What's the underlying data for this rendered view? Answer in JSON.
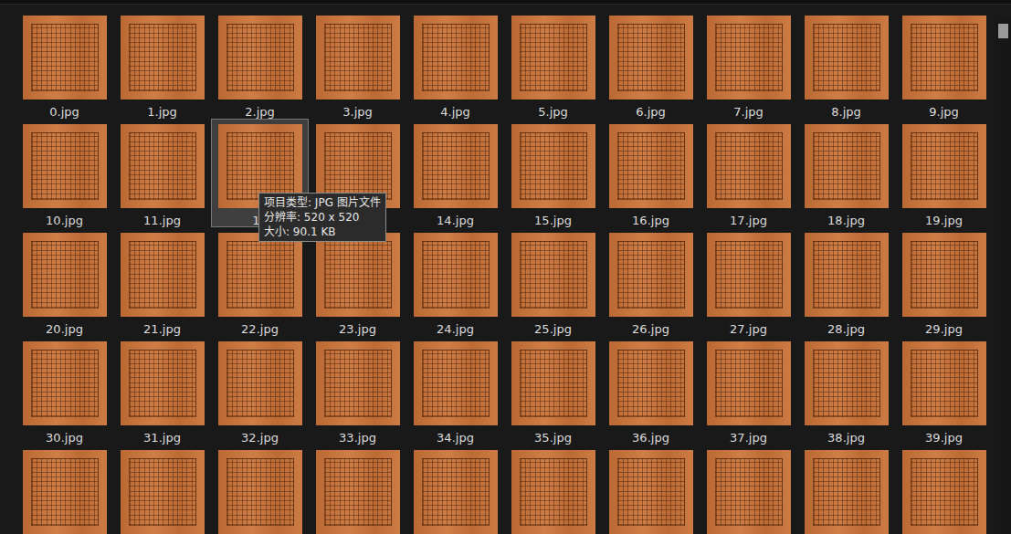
{
  "files": [
    {
      "name": "0.jpg",
      "selected": false
    },
    {
      "name": "1.jpg",
      "selected": false
    },
    {
      "name": "2.jpg",
      "selected": false
    },
    {
      "name": "3.jpg",
      "selected": false
    },
    {
      "name": "4.jpg",
      "selected": false
    },
    {
      "name": "5.jpg",
      "selected": false
    },
    {
      "name": "6.jpg",
      "selected": false
    },
    {
      "name": "7.jpg",
      "selected": false
    },
    {
      "name": "8.jpg",
      "selected": false
    },
    {
      "name": "9.jpg",
      "selected": false
    },
    {
      "name": "10.jpg",
      "selected": false
    },
    {
      "name": "11.jpg",
      "selected": false
    },
    {
      "name": "12",
      "selected": true
    },
    {
      "name": "13.jpg",
      "selected": false
    },
    {
      "name": "14.jpg",
      "selected": false
    },
    {
      "name": "15.jpg",
      "selected": false
    },
    {
      "name": "16.jpg",
      "selected": false
    },
    {
      "name": "17.jpg",
      "selected": false
    },
    {
      "name": "18.jpg",
      "selected": false
    },
    {
      "name": "19.jpg",
      "selected": false
    },
    {
      "name": "20.jpg",
      "selected": false
    },
    {
      "name": "21.jpg",
      "selected": false
    },
    {
      "name": "22.jpg",
      "selected": false
    },
    {
      "name": "23.jpg",
      "selected": false
    },
    {
      "name": "24.jpg",
      "selected": false
    },
    {
      "name": "25.jpg",
      "selected": false
    },
    {
      "name": "26.jpg",
      "selected": false
    },
    {
      "name": "27.jpg",
      "selected": false
    },
    {
      "name": "28.jpg",
      "selected": false
    },
    {
      "name": "29.jpg",
      "selected": false
    },
    {
      "name": "30.jpg",
      "selected": false
    },
    {
      "name": "31.jpg",
      "selected": false
    },
    {
      "name": "32.jpg",
      "selected": false
    },
    {
      "name": "33.jpg",
      "selected": false
    },
    {
      "name": "34.jpg",
      "selected": false
    },
    {
      "name": "35.jpg",
      "selected": false
    },
    {
      "name": "36.jpg",
      "selected": false
    },
    {
      "name": "37.jpg",
      "selected": false
    },
    {
      "name": "38.jpg",
      "selected": false
    },
    {
      "name": "39.jpg",
      "selected": false
    },
    {
      "selected": false
    },
    {
      "selected": false
    },
    {
      "selected": false
    },
    {
      "selected": false
    },
    {
      "selected": false
    },
    {
      "selected": false
    },
    {
      "selected": false
    },
    {
      "selected": false
    },
    {
      "selected": false
    },
    {
      "selected": false
    }
  ],
  "tooltip": {
    "lines": [
      "项目类型: JPG 图片文件",
      "分辨率: 520 x 520",
      "大小: 90.1 KB"
    ]
  }
}
